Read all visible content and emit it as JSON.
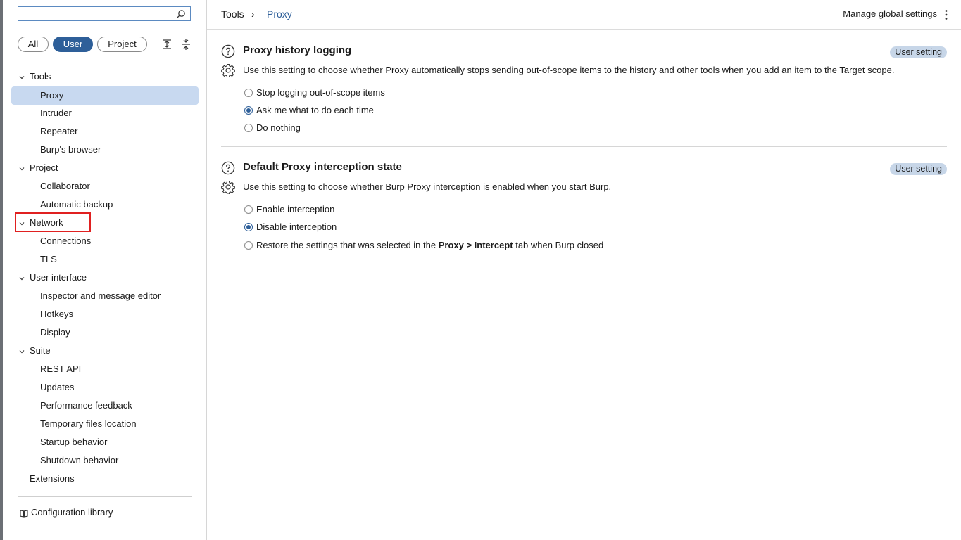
{
  "search": {
    "placeholder": "",
    "value": ""
  },
  "filters": [
    "All",
    "User",
    "Project"
  ],
  "filter_active": "User",
  "sidebar": {
    "groups": [
      {
        "label": "Tools",
        "children": [
          "Proxy",
          "Intruder",
          "Repeater",
          "Burp's browser"
        ]
      },
      {
        "label": "Project",
        "children": [
          "Collaborator",
          "Automatic backup"
        ]
      },
      {
        "label": "Network",
        "children": [
          "Connections",
          "TLS"
        ]
      },
      {
        "label": "User interface",
        "children": [
          "Inspector and message editor",
          "Hotkeys",
          "Display"
        ]
      },
      {
        "label": "Suite",
        "children": [
          "REST API",
          "Updates",
          "Performance feedback",
          "Temporary files location",
          "Startup behavior",
          "Shutdown behavior"
        ]
      }
    ],
    "extensions": "Extensions",
    "config_library": "Configuration library"
  },
  "header": {
    "crumb_tools": "Tools",
    "crumb_sep": "›",
    "crumb_proxy": "Proxy",
    "manage": "Manage global settings"
  },
  "sections": [
    {
      "title": "Proxy history logging",
      "badge": "User setting",
      "desc": "Use this setting to choose whether Proxy automatically stops sending out-of-scope items to the history and other tools when you add an item to the Target scope.",
      "options": [
        "Stop logging out-of-scope items",
        "Ask me what to do each time",
        "Do nothing"
      ],
      "selected": 1
    },
    {
      "title": "Default Proxy interception state",
      "badge": "User setting",
      "desc": "Use this setting to choose whether Burp Proxy interception is enabled when you start Burp.",
      "options": [
        "Enable interception",
        "Disable interception"
      ],
      "option3_pre": "Restore the settings that was selected in the",
      "option3_bold": "Proxy > Intercept",
      "option3_post": "tab when Burp closed",
      "selected": 1
    }
  ],
  "colors": {
    "accent": "#2e5f99",
    "selected_bg": "#c8d9f0",
    "badge_bg": "#c7d6e8",
    "highlight": "#e02020"
  }
}
